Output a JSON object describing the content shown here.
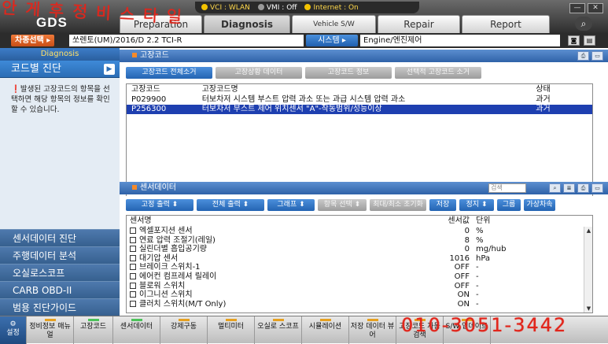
{
  "status": {
    "vci": "VCI : WLAN",
    "vmi": "VMI : Off",
    "internet": "Internet : On"
  },
  "logo": "GDS",
  "tabs": [
    "Preparation",
    "Diagnosis",
    "Vehicle S/W Management",
    "Repair",
    "Report"
  ],
  "window_controls": [
    "—",
    "✕"
  ],
  "vehicle_bar": {
    "vehicle_label": "차종선택",
    "vehicle_name": "쏘렌토(UM)/2016/D 2.2 TCI-R",
    "system_label": "시스템",
    "system_name": "Engine/엔진제어"
  },
  "sidebar": {
    "header": "Diagnosis",
    "selected": "코드별 진단",
    "help_text": "발생된 고장코드의 항목을 선택하면 해당 항목의 정보를 확인 할 수 있습니다.",
    "menu": [
      "센서데이터 진단",
      "주행데이터 분석",
      "오실로스코프",
      "CARB OBD-II",
      "범용 진단가이드"
    ]
  },
  "dtc_panel": {
    "title": "고장코드",
    "buttons": [
      "고장코드 전체소거",
      "고장상황 데이터",
      "고장코드 정보",
      "선택적 고장코드 소거"
    ],
    "columns": [
      "고장코드",
      "고장코드명",
      "상태"
    ],
    "rows": [
      {
        "code": "P029900",
        "name": "터보차저 시스템 부스트 압력 과소 또는 과급 시스템 압력 과소",
        "status": "과거"
      },
      {
        "code": "P256300",
        "name": "터보차저 부스트 제어 위치센서 \"A\"-작동범위/성능이상",
        "status": "과거"
      }
    ]
  },
  "sensor_panel": {
    "title": "센서데이터",
    "search_placeholder": "검색",
    "buttons": [
      "고정 출력",
      "전체 출력",
      "그래프",
      "항목 선택",
      "최대/최소 초기화",
      "저장",
      "정지",
      "그룹",
      "가상차속"
    ],
    "columns": [
      "센서명",
      "센서값",
      "단위"
    ],
    "rows": [
      {
        "name": "엑셀포지션 센서",
        "value": "0",
        "unit": "%"
      },
      {
        "name": "연료 압력 조절기(레일)",
        "value": "8",
        "unit": "%"
      },
      {
        "name": "실린더별 흡입공기량",
        "value": "0",
        "unit": "mg/hub"
      },
      {
        "name": "대기압 센서",
        "value": "1016",
        "unit": "hPa"
      },
      {
        "name": "브레이크 스위치-1",
        "value": "OFF",
        "unit": "-"
      },
      {
        "name": "에어컨 컴프레셔 릴레이",
        "value": "OFF",
        "unit": "-"
      },
      {
        "name": "블로워 스위치",
        "value": "OFF",
        "unit": "-"
      },
      {
        "name": "이그니션 스위치",
        "value": "ON",
        "unit": "-"
      },
      {
        "name": "클러치 스위치(M/T Only)",
        "value": "ON",
        "unit": "-"
      }
    ]
  },
  "bottom_bar": [
    "설정",
    "정비정보 매뉴얼",
    "고장코드",
    "센서데이터",
    "강제구동",
    "멀티미터",
    "오실로 스코프",
    "시뮬레이션",
    "저장 데이터 뷰어",
    "고장코드 자동검색",
    "S/W 업데이트"
  ],
  "handwriting": {
    "top": "안 게 후 정 비 스 타 일",
    "bottom": "010-3051-3442"
  }
}
